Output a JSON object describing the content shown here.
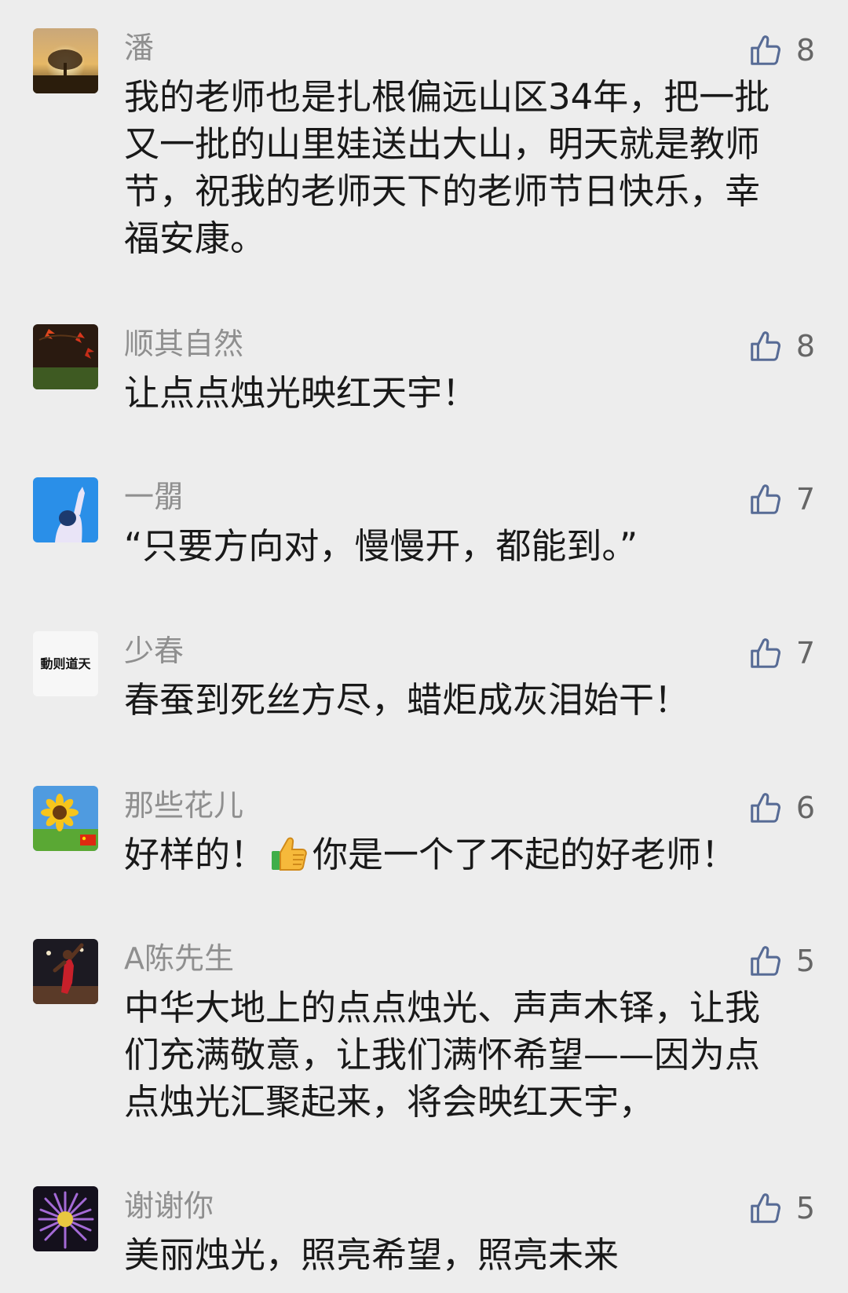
{
  "comments": [
    {
      "author": "潘",
      "likes": "8",
      "lines": [
        "我的老师也是扎根偏远山区34年，把一批",
        "又一批的山里娃送出大山，明天就是教师",
        "节，祝我的老师天下的老师节日快乐，幸",
        "福安康。"
      ]
    },
    {
      "author": "顺其自然",
      "likes": "8",
      "lines": [
        "让点点烛光映红天宇！"
      ]
    },
    {
      "author": "一朤",
      "likes": "7",
      "lines": [
        "“只要方向对，慢慢开，都能到。”"
      ]
    },
    {
      "author": "少春",
      "likes": "7",
      "avatar_text": "動则道天",
      "lines": [
        "春蚕到死丝方尽，蜡炬成灰泪始干！"
      ]
    },
    {
      "author": "那些花儿",
      "likes": "6",
      "text_before_emoji": "好样的！",
      "emoji_icon": "thumbs-up-emoji",
      "text_after_emoji": "你是一个了不起的好老师！"
    },
    {
      "author": "A陈先生",
      "likes": "5",
      "lines": [
        "中华大地上的点点烛光、声声木铎，让我",
        "们充满敬意，让我们满怀希望——因为点",
        "点烛光汇聚起来，将会映红天宇，"
      ]
    },
    {
      "author": "谢谢你",
      "likes": "5",
      "lines": [
        "美丽烛光，照亮希望，照亮未来"
      ]
    }
  ],
  "like_icon": "thumbs-up-outline-icon",
  "colors": {
    "background": "#ededed",
    "author": "#8f8f8f",
    "content": "#191919",
    "like_icon": "#576b95"
  }
}
